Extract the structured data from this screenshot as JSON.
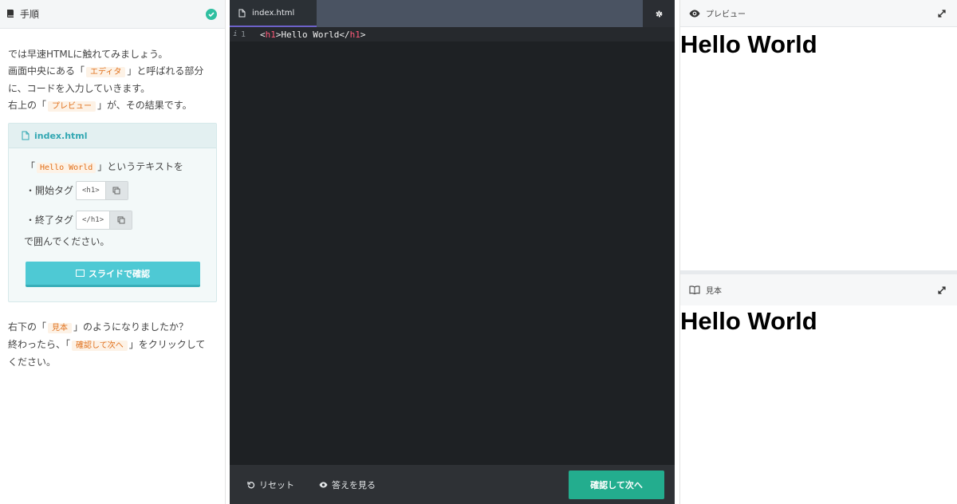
{
  "left_panel": {
    "title": "手順",
    "steps": {
      "line1": "では早速HTMLに触れてみましょう。",
      "line2_pre": "画面中央にある「",
      "line2_hl": "エディタ",
      "line2_post": "」と呼ばれる部分",
      "line3": "に、コードを入力していきます。",
      "line4_pre": "右上の「",
      "line4_hl": "プレビュー",
      "line4_post": "」が、その結果です。"
    },
    "task": {
      "filename": "index.html",
      "text_pre": "「",
      "text_hl": "Hello World",
      "text_post": "」というテキストを",
      "open_label": "・開始タグ",
      "open_code": "<h1>",
      "close_label": "・終了タグ",
      "close_code": "</h1>",
      "end_text": "で囲んでください。",
      "slide_button": "スライドで確認"
    },
    "bottom": {
      "line1_pre": "右下の「",
      "line1_hl": "見本",
      "line1_post": "」のようになりましたか？",
      "line2_pre": "終わったら、「",
      "line2_hl": "確認して次へ",
      "line2_post": "」をクリックして",
      "line3": "ください。"
    }
  },
  "editor": {
    "tab_label": "index.html",
    "gutter_info": "i",
    "line_number": "1",
    "code": {
      "open_bracket": "<",
      "open_tag": "h1",
      "open_close_bracket": ">",
      "content": "Hello World",
      "close_bracket": "</",
      "close_tag": "h1",
      "close_end": ">"
    },
    "reset_label": "リセット",
    "answer_label": "答えを見る",
    "next_label": "確認して次へ"
  },
  "preview": {
    "title": "プレビュー",
    "heading": "Hello World"
  },
  "sample": {
    "title": "見本",
    "heading": "Hello World"
  },
  "colors": {
    "accent_teal": "#4ec9d4",
    "next_green": "#23ad8e",
    "highlight_orange": "#e0701b",
    "tab_underline": "#6d62c9"
  }
}
